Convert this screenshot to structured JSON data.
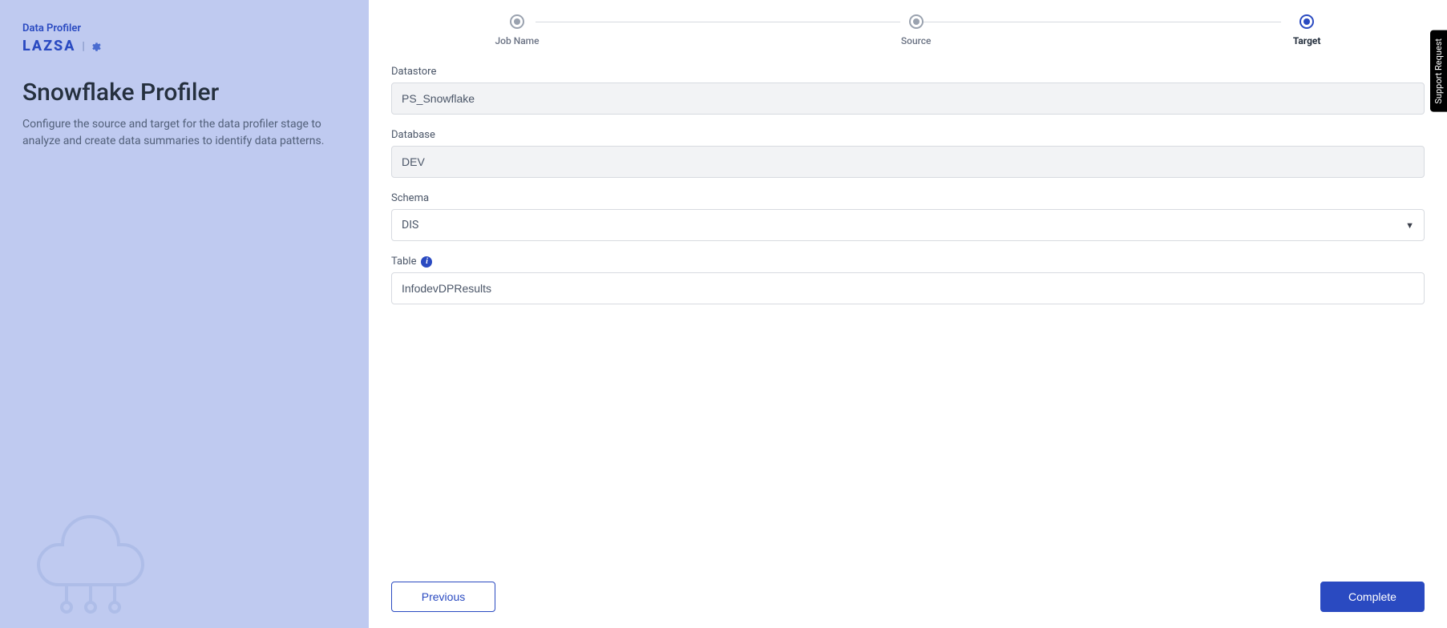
{
  "sidebar": {
    "brand_label": "Data Profiler",
    "brand_name": "LAZSA",
    "title": "Snowflake Profiler",
    "subtitle": "Configure the source and target for the data profiler stage to analyze and create data summaries to identify data patterns."
  },
  "stepper": {
    "step1": {
      "label": "Job Name",
      "state": "completed"
    },
    "step2": {
      "label": "Source",
      "state": "completed"
    },
    "step3": {
      "label": "Target",
      "state": "active"
    }
  },
  "fields": {
    "datastore": {
      "label": "Datastore",
      "value": "PS_Snowflake"
    },
    "database": {
      "label": "Database",
      "value": "DEV"
    },
    "schema": {
      "label": "Schema",
      "value": "DIS"
    },
    "table": {
      "label": "Table",
      "value": "InfodevDPResults"
    }
  },
  "footer": {
    "previous": "Previous",
    "complete": "Complete"
  },
  "support_label": "Support Request"
}
